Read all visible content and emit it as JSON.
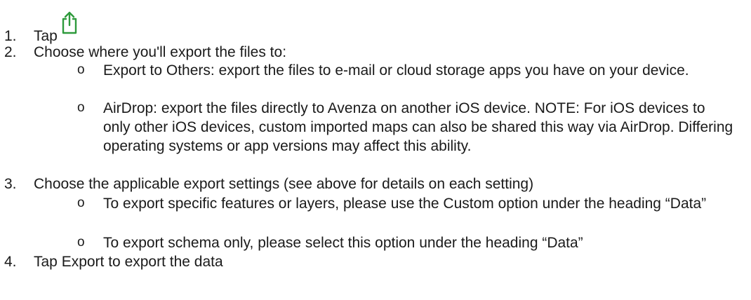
{
  "colors": {
    "text": "#1a1a1a",
    "icon": "#2e9a3c"
  },
  "steps": [
    {
      "number": "1.",
      "text": "Tap",
      "icon": "share-icon"
    },
    {
      "number": "2.",
      "text": "Choose where you'll export the files to:",
      "subitems": [
        {
          "bullet": "o",
          "text": "Export to Others: export the files to e-mail or cloud storage apps you have on your device."
        },
        {
          "bullet": "o",
          "text": "AirDrop: export the files directly to Avenza on another iOS device. NOTE: For iOS devices to only other iOS devices, custom imported maps can also be shared this way via AirDrop. Differing operating systems or app versions may affect this ability."
        }
      ]
    },
    {
      "number": "3.",
      "text": "Choose the applicable export settings (see above for details on each setting)",
      "subitems": [
        {
          "bullet": "o",
          "text": "To export specific features or layers, please use the Custom option under the heading “Data”"
        },
        {
          "bullet": "o",
          "text": "To export schema only, please select this option under the heading “Data”"
        }
      ]
    },
    {
      "number": "4.",
      "text": "Tap Export to export the data"
    }
  ]
}
